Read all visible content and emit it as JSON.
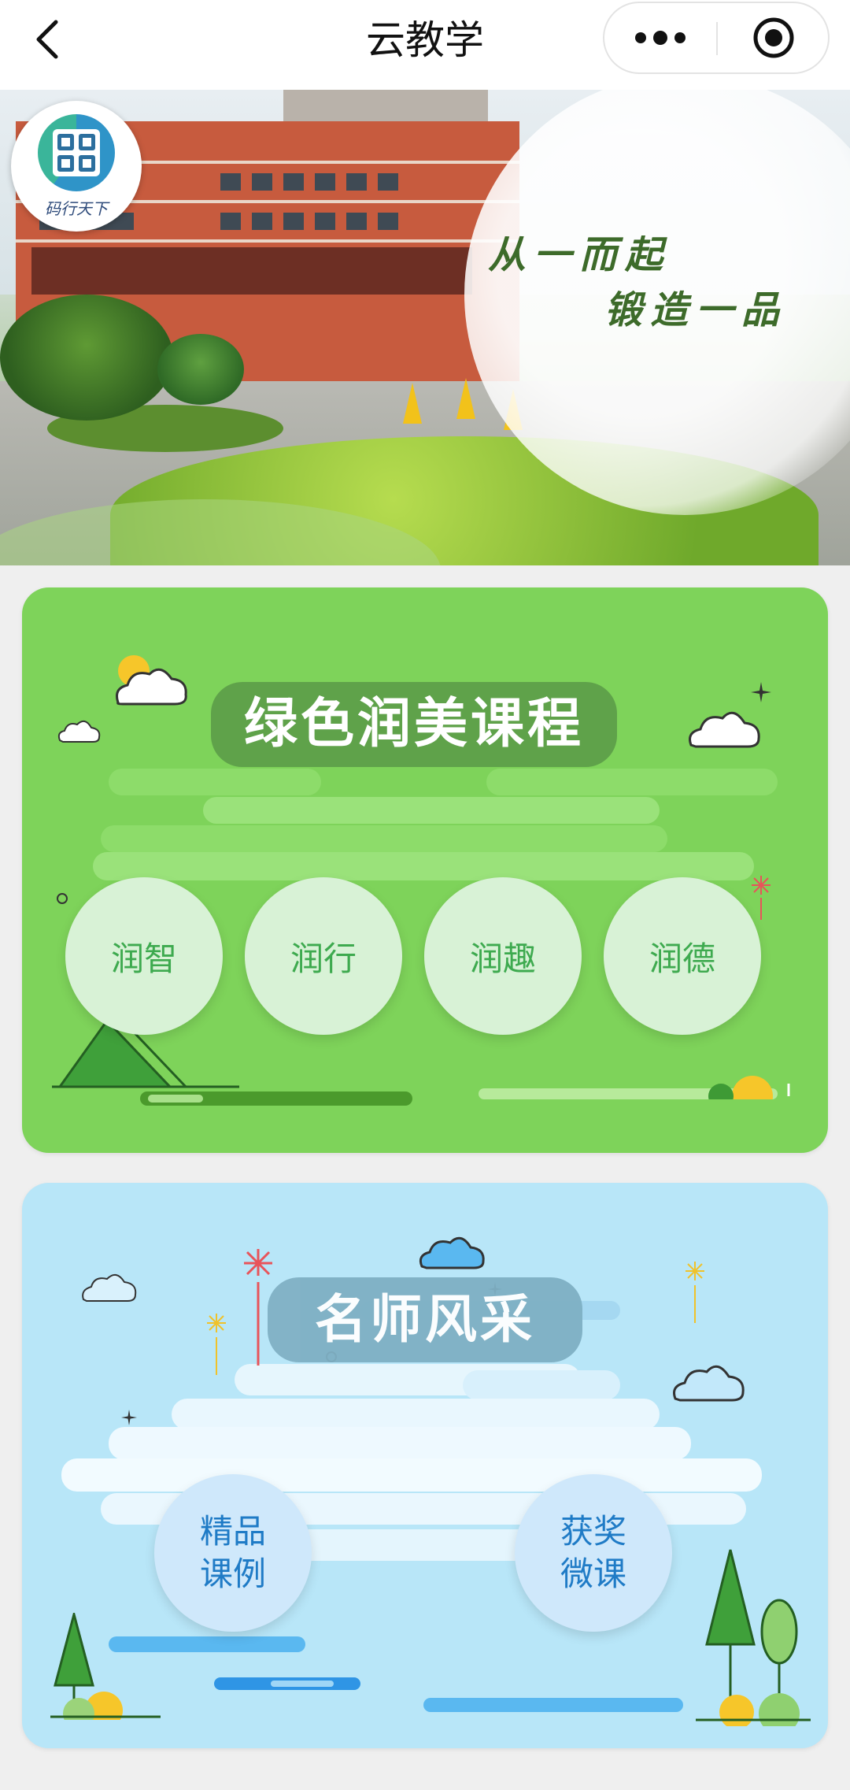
{
  "navbar": {
    "title": "云教学",
    "back_icon": "chevron-left-icon",
    "more_icon": "more-dots-icon",
    "target_icon": "target-icon"
  },
  "banner": {
    "slogan_line1": "从一而起",
    "slogan_line2": "锻造一品",
    "logo_text": "码行天下"
  },
  "card_green": {
    "title": "绿色润美课程",
    "items": [
      "润智",
      "润行",
      "润趣",
      "润德"
    ],
    "accent": "#7ed35a"
  },
  "card_blue": {
    "title": "名师风采",
    "items": [
      {
        "line1": "精品",
        "line2": "课例"
      },
      {
        "line1": "获奖",
        "line2": "微课"
      }
    ],
    "accent": "#b8e6f8"
  }
}
